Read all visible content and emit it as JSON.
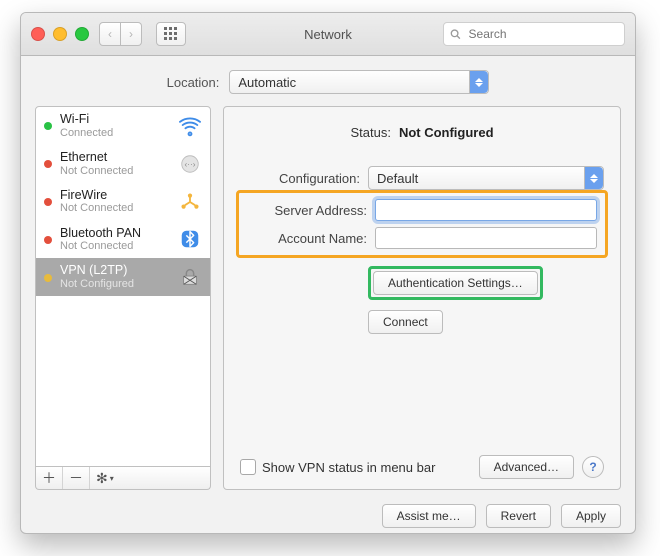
{
  "window": {
    "title": "Network",
    "search_placeholder": "Search"
  },
  "location": {
    "label": "Location:",
    "value": "Automatic"
  },
  "sidebar": {
    "services": [
      {
        "name": "Wi-Fi",
        "status": "Connected",
        "dot": "green",
        "icon": "wifi"
      },
      {
        "name": "Ethernet",
        "status": "Not Connected",
        "dot": "red",
        "icon": "ethernet"
      },
      {
        "name": "FireWire",
        "status": "Not Connected",
        "dot": "red",
        "icon": "firewire"
      },
      {
        "name": "Bluetooth PAN",
        "status": "Not Connected",
        "dot": "red",
        "icon": "bluetooth"
      },
      {
        "name": "VPN (L2TP)",
        "status": "Not Configured",
        "dot": "yellow",
        "icon": "vpn",
        "selected": true
      }
    ]
  },
  "detail": {
    "status_label": "Status:",
    "status_value": "Not Configured",
    "configuration_label": "Configuration:",
    "configuration_value": "Default",
    "server_address_label": "Server Address:",
    "server_address_value": "",
    "account_name_label": "Account Name:",
    "account_name_value": "",
    "auth_settings_label": "Authentication Settings…",
    "connect_label": "Connect",
    "show_in_menubar_label": "Show VPN status in menu bar",
    "advanced_label": "Advanced…"
  },
  "footer": {
    "assist_label": "Assist me…",
    "revert_label": "Revert",
    "apply_label": "Apply"
  }
}
